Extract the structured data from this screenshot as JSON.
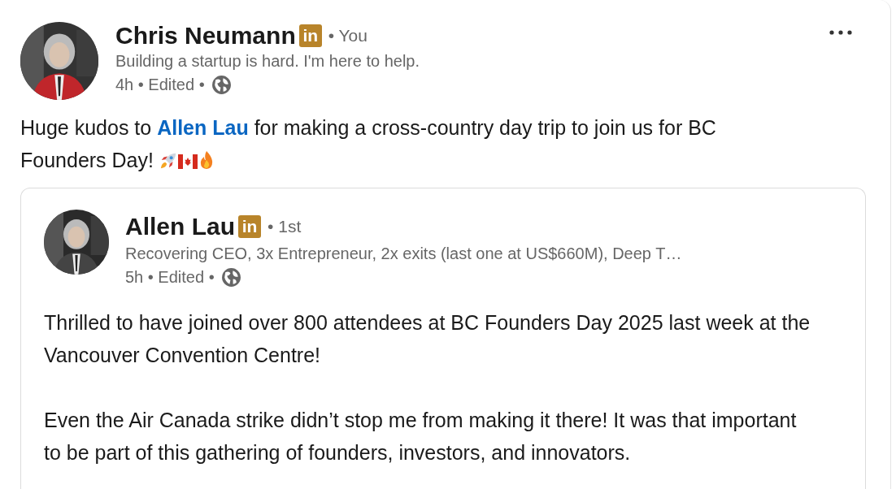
{
  "post": {
    "author": {
      "name": "Chris Neumann",
      "badge": "in",
      "relation": "• You",
      "headline": "Building a startup is hard. I'm here to help.",
      "meta": "4h • Edited •"
    },
    "text": {
      "before": "Huge kudos to ",
      "mention": "Allen Lau",
      "after": " for making a cross-country day trip to join us for BC Founders Day!"
    },
    "shared_post": {
      "author": {
        "name": "Allen Lau",
        "badge": "in",
        "relation": "• 1st",
        "headline": "Recovering CEO, 3x Entrepreneur, 2x exits (last one at US$660M), Deep T…",
        "meta": "5h • Edited •"
      },
      "paragraphs": [
        "Thrilled to have joined over 800 attendees at BC Founders Day 2025 last week at the Vancouver Convention Centre!",
        "Even the Air Canada strike didn’t stop me from making it there! It was that important to be part of this gathering of founders, investors, and innovators."
      ]
    }
  }
}
